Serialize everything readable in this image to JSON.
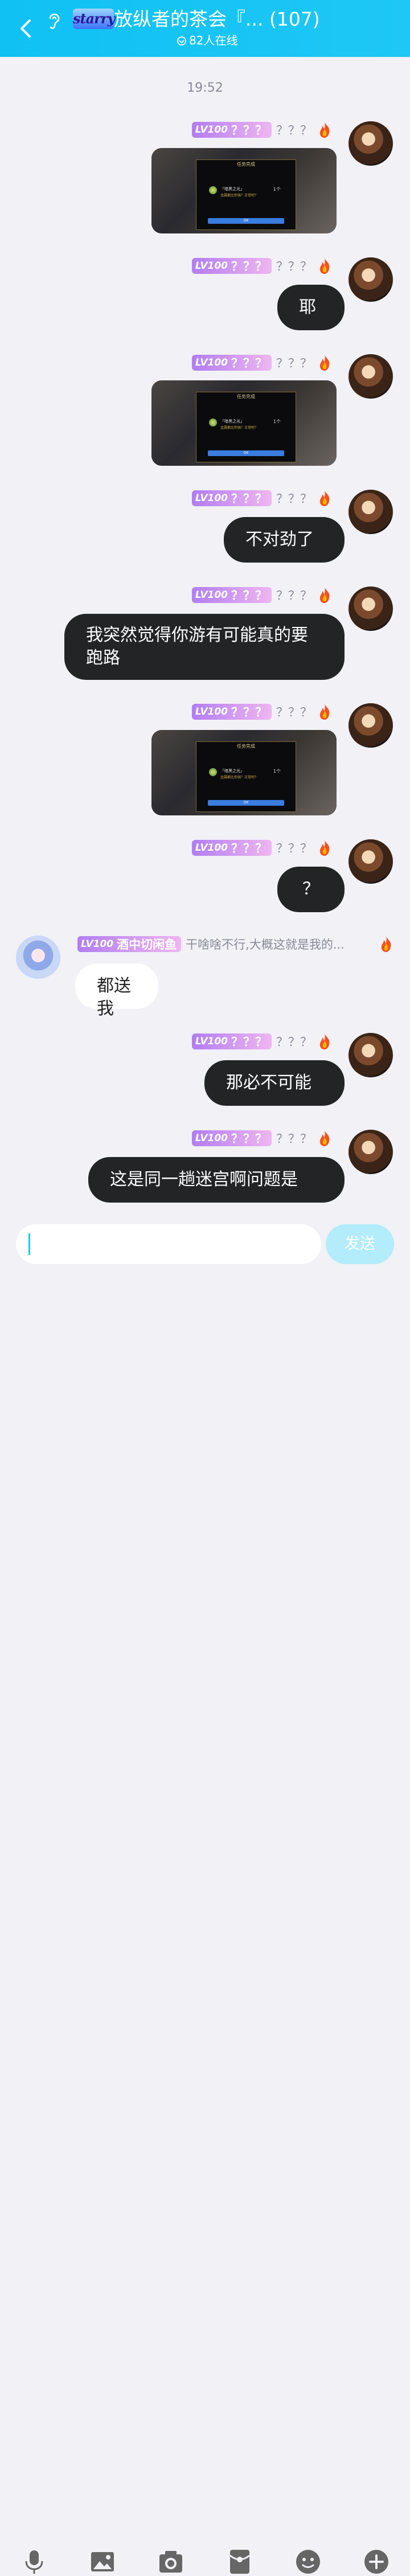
{
  "header": {
    "logo_text": "starry",
    "title": "放纵者的茶会『... (107)",
    "online": "82人在线"
  },
  "timestamp": "19:52",
  "self_badge": {
    "level": "LV100",
    "name": "？？？",
    "signature": "？？？"
  },
  "shot": {
    "dialog_title": "任务完成",
    "item_name": "「暗黑之光」",
    "item_desc": "金属都比你强？正常吧？",
    "count": "1个",
    "ok": "OK"
  },
  "messages": [
    {
      "kind": "image"
    },
    {
      "kind": "text",
      "text": "耶"
    },
    {
      "kind": "image"
    },
    {
      "kind": "text",
      "text": "不对劲了"
    },
    {
      "kind": "text",
      "text": "我突然觉得你游有可能真的要跑路"
    },
    {
      "kind": "image"
    },
    {
      "kind": "text",
      "text": "？"
    },
    {
      "kind": "text_other",
      "level": "LV100",
      "name": "酒中切闲鱼",
      "signature": "干啥啥不行,大概这就是我的...",
      "text": "都送我"
    },
    {
      "kind": "text",
      "text": "那必不可能"
    },
    {
      "kind": "text",
      "text": "这是同一趟迷宫啊问题是"
    }
  ],
  "input": {
    "value": "",
    "send_label": "发送"
  },
  "toolbar": [
    "microphone-icon",
    "image-icon",
    "camera-icon",
    "red-packet-icon",
    "emoji-icon",
    "plus-icon"
  ],
  "colors": {
    "header": "#10c1f4",
    "accent": "#1ec7f5",
    "bubble_dark": "#222426",
    "badge": "#b27df2"
  }
}
